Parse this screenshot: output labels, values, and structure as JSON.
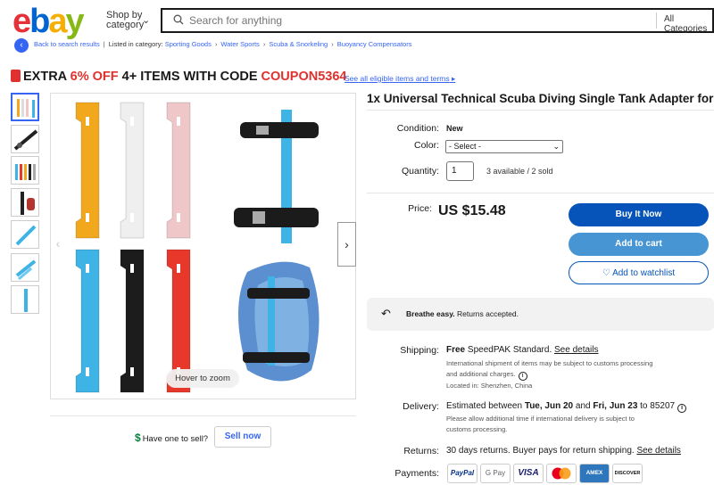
{
  "header": {
    "logo": [
      "e",
      "b",
      "a",
      "y"
    ],
    "shop_by": "Shop by",
    "category": "category",
    "search_placeholder": "Search for anything",
    "category_select": "All Categories"
  },
  "breadcrumb": {
    "back": "Back to search results",
    "listed_in": "Listed in category:",
    "items": [
      "Sporting Goods",
      "Water Sports",
      "Scuba & Snorkeling",
      "Buoyancy Compensators"
    ]
  },
  "promo": {
    "prefix": "EXTRA ",
    "pct": "6% OFF",
    "middle": " 4+ ITEMS WITH CODE ",
    "code": "COUPON5364",
    "link": "See all eligible items and terms"
  },
  "gallery": {
    "hover_zoom": "Hover to zoom",
    "thumb_count": 7,
    "strap_colors": [
      "#f2a81d",
      "#efefef",
      "#f0c7c9",
      "#3db3e6",
      "#1c1c1c",
      "#e8372b"
    ]
  },
  "sell": {
    "question": "Have one to sell?",
    "button": "Sell now"
  },
  "item": {
    "title": "1x Universal Technical Scuba Diving Single Tank Adapter for",
    "condition_label": "Condition:",
    "condition_value": "New",
    "color_label": "Color:",
    "color_value": "- Select -",
    "quantity_label": "Quantity:",
    "quantity_value": "1",
    "availability": "3 available / 2 sold",
    "price_label": "Price:",
    "price_value": "US $15.48"
  },
  "actions": {
    "buy_now": "Buy It Now",
    "add_to_cart": "Add to cart",
    "watchlist": "Add to watchlist"
  },
  "returns_banner": {
    "bold": "Breathe easy.",
    "text": " Returns accepted."
  },
  "shipping": {
    "label": "Shipping:",
    "free": "Free",
    "method": " SpeedPAK Standard. ",
    "details_link": "See details",
    "note1": "International shipment of items may be subject to customs processing",
    "note2": "and additional charges.",
    "location": "Located in: Shenzhen, China"
  },
  "delivery": {
    "label": "Delivery:",
    "pre": "Estimated between ",
    "d1": "Tue, Jun 20",
    "and": " and ",
    "d2": "Fri, Jun 23",
    "post": " to 85207",
    "note1": "Please allow additional time if international delivery is subject to",
    "note2": "customs processing."
  },
  "returns": {
    "label": "Returns:",
    "text": "30 days returns. Buyer pays for return shipping. ",
    "link": "See details"
  },
  "payments": {
    "label": "Payments:",
    "methods": [
      "PayPal",
      "G Pay",
      "VISA",
      "Mastercard",
      "AMEX",
      "DISCOVER"
    ]
  }
}
